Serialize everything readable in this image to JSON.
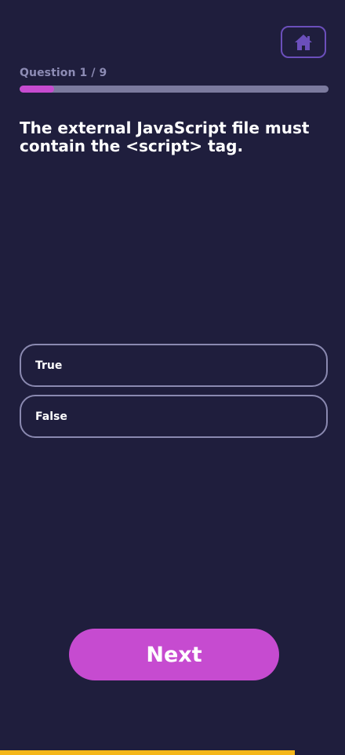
{
  "header": {
    "home_icon": "home-icon"
  },
  "quiz": {
    "counter_text": "Question 1 / 9",
    "current_question": 1,
    "total_questions": 9,
    "question_text": "The external JavaScript file must contain the <script> tag.",
    "options": [
      {
        "label": "True"
      },
      {
        "label": "False"
      }
    ]
  },
  "footer": {
    "next_label": "Next",
    "bottom_bar_fraction": 0.855
  },
  "colors": {
    "background": "#1f1e3d",
    "accent": "#c64bd0",
    "track": "#7b7a9e",
    "home_icon": "#6b4fbb",
    "bottom_bar": "#f5b719"
  }
}
